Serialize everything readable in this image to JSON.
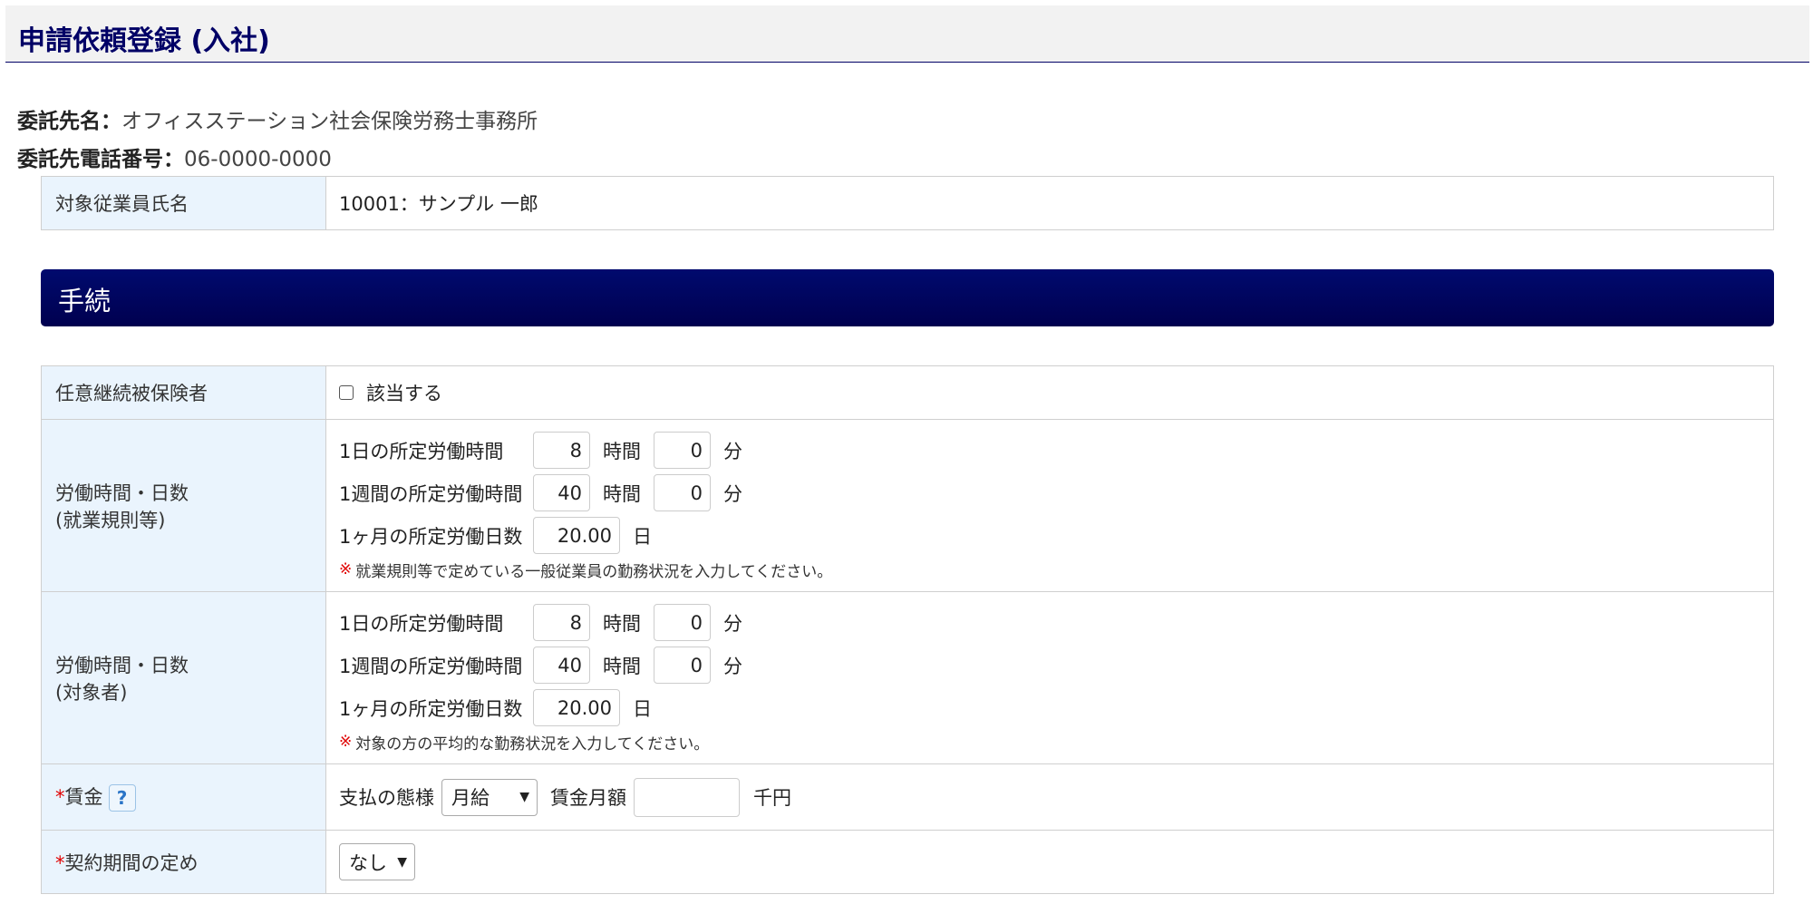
{
  "page": {
    "title": "申請依頼登録 (入社)"
  },
  "consignee": {
    "name_label": "委託先名：",
    "name_value": "オフィスステーション社会保険労務士事務所",
    "phone_label": "委託先電話番号：",
    "phone_value": "06-0000-0000"
  },
  "employee": {
    "label": "対象従業員氏名",
    "value": "10001：サンプル 一郎"
  },
  "section": {
    "title": "手続"
  },
  "optional_insured": {
    "label": "任意継続被保険者",
    "checkbox_label": "該当する",
    "checked": false
  },
  "work_rules": {
    "label_line1": "労働時間・日数",
    "label_line2": "(就業規則等)",
    "daily_label": "1日の所定労働時間",
    "daily_hours": "8",
    "daily_minutes": "0",
    "weekly_label": "1週間の所定労働時間",
    "weekly_hours": "40",
    "weekly_minutes": "0",
    "monthly_label": "1ヶ月の所定労働日数",
    "monthly_days": "20.00",
    "note": "就業規則等で定めている一般従業員の勤務状況を入力してください。"
  },
  "target_person": {
    "label_line1": "労働時間・日数",
    "label_line2": "(対象者)",
    "daily_label": "1日の所定労働時間",
    "daily_hours": "8",
    "daily_minutes": "0",
    "weekly_label": "1週間の所定労働時間",
    "weekly_hours": "40",
    "weekly_minutes": "0",
    "monthly_label": "1ヶ月の所定労働日数",
    "monthly_days": "20.00",
    "note": "対象の方の平均的な勤務状況を入力してください。"
  },
  "units": {
    "hours": "時間",
    "minutes": "分",
    "days": "日",
    "asterisk_note": "※"
  },
  "wage": {
    "required_mark": "*",
    "label": "賃金",
    "help_icon": "?",
    "payment_label": "支払の態様",
    "payment_selected": "月給",
    "monthly_label": "賃金月額",
    "monthly_value": "",
    "unit": "千円"
  },
  "contract": {
    "required_mark": "*",
    "label": "契約期間の定め",
    "selected": "なし"
  },
  "icons": {
    "select_arrow": "chevron-down-icon",
    "help": "question-icon"
  },
  "colors": {
    "header_text": "#000066",
    "section_bar": "#00004f",
    "label_bg": "#eaf4fd",
    "required": "#e00000"
  }
}
